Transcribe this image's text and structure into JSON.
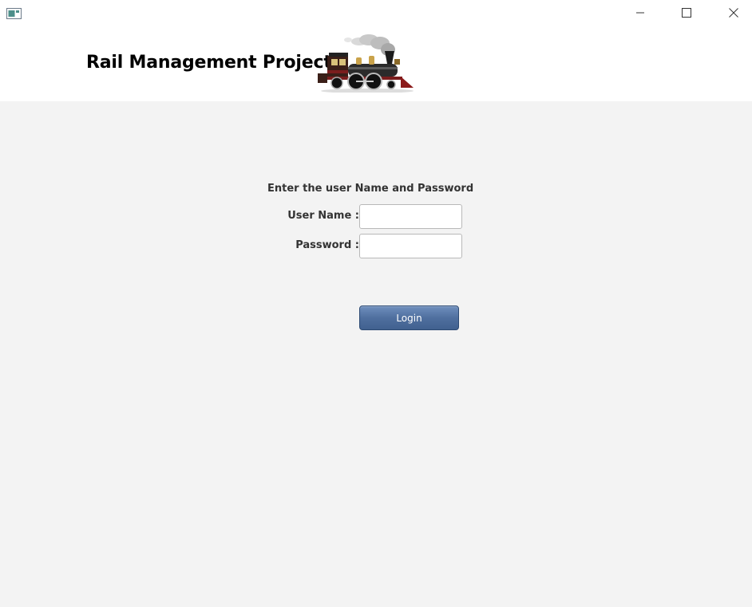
{
  "window": {
    "controls": {
      "minimize_icon": "minimize-icon",
      "maximize_icon": "maximize-icon",
      "close_icon": "close-icon"
    }
  },
  "header": {
    "title": "Rail Management Project",
    "logo": "steam-locomotive-icon"
  },
  "login": {
    "prompt": "Enter the user Name and Password",
    "username_label": "User Name :",
    "username_value": "",
    "password_label": "Password :",
    "password_value": "",
    "button_label": "Login"
  },
  "colors": {
    "content_background": "#f3f3f3",
    "header_background": "#ffffff",
    "button_accent": "#4f6f9f"
  }
}
